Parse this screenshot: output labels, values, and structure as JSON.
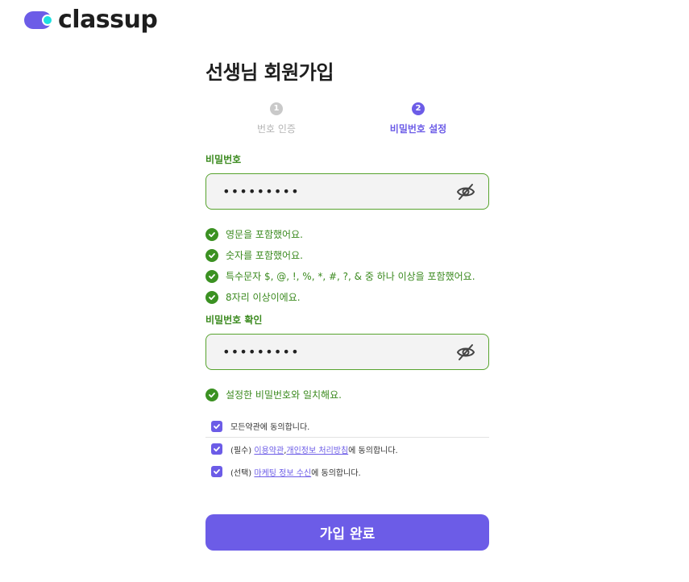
{
  "brand": {
    "logo_text": "classup",
    "accent": "#6c5ce7",
    "logo_dot": "#1ee0e0"
  },
  "page_title": "선생님 회원가입",
  "steps": [
    {
      "number": "1",
      "label": "번호 인증",
      "state": "done"
    },
    {
      "number": "2",
      "label": "비밀번호 설정",
      "state": "active"
    }
  ],
  "password": {
    "label": "비밀번호",
    "value": "•••••••••",
    "toggle_icon": "eye-off-icon",
    "rules": [
      "영문을 포함했어요.",
      "숫자를 포함했어요.",
      "특수문자 $, @, !, %, *, #, ?, & 중 하나 이상을 포함했어요.",
      "8자리 이상이에요."
    ]
  },
  "password_confirm": {
    "label": "비밀번호 확인",
    "value": "•••••••••",
    "toggle_icon": "eye-off-icon",
    "rules": [
      "설정한 비밀번호와 일치해요."
    ]
  },
  "agreements": {
    "all": {
      "text": "모든약관에 동의합니다.",
      "checked": true
    },
    "required": {
      "prefix": "(필수) ",
      "link1": "이용약관",
      "separator": ",",
      "link2": "개인정보 처리방침",
      "suffix": "에 동의합니다.",
      "checked": true
    },
    "optional": {
      "prefix": "(선택) ",
      "link": "마케팅 정보 수신",
      "suffix": "에 동의합니다.",
      "checked": true
    }
  },
  "submit_label": "가입 완료",
  "colors": {
    "success": "#3b9122",
    "input_bg": "#f3f3f3",
    "step_inactive": "#c9c9c9"
  }
}
